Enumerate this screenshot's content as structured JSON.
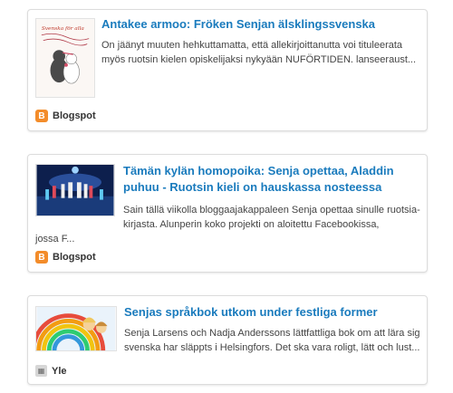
{
  "articles": [
    {
      "title": "Antakee armoo: Fröken Senjan älsklingssvenska",
      "snippet": "On jäänyt muuten hehkuttamatta, että allekirjoittanutta voi tituleerata myös ruotsin kielen opiskelijaksi nykyään NUFÖRTIDEN. lanseeraust...",
      "source": "Blogspot",
      "source_icon": "blogger-icon",
      "thumb_text": "Svenska för alla"
    },
    {
      "title": "Tämän kylän homopoika: Senja opettaa, Aladdin puhuu - Ruotsin kieli on hauskassa nosteessa",
      "snippet": "Sain tällä viikolla bloggaajakappaleen Senja opettaa sinulle ruotsia-kirjasta. Alunperin koko projekti on aloitettu Facebookissa,",
      "snippet_cont": "jossa F...",
      "source": "Blogspot",
      "source_icon": "blogger-icon"
    },
    {
      "title": "Senjas språkbok utkom under festliga former",
      "snippet": "Senja Larsens och Nadja Anderssons lättfattliga bok om att lära sig svenska har släppts i Helsingfors. Det ska vara roligt, lätt och lust...",
      "source": "Yle",
      "source_icon": "yle-icon"
    }
  ],
  "colors": {
    "title": "#1a7bbd",
    "blogger": "#f38c2a"
  }
}
